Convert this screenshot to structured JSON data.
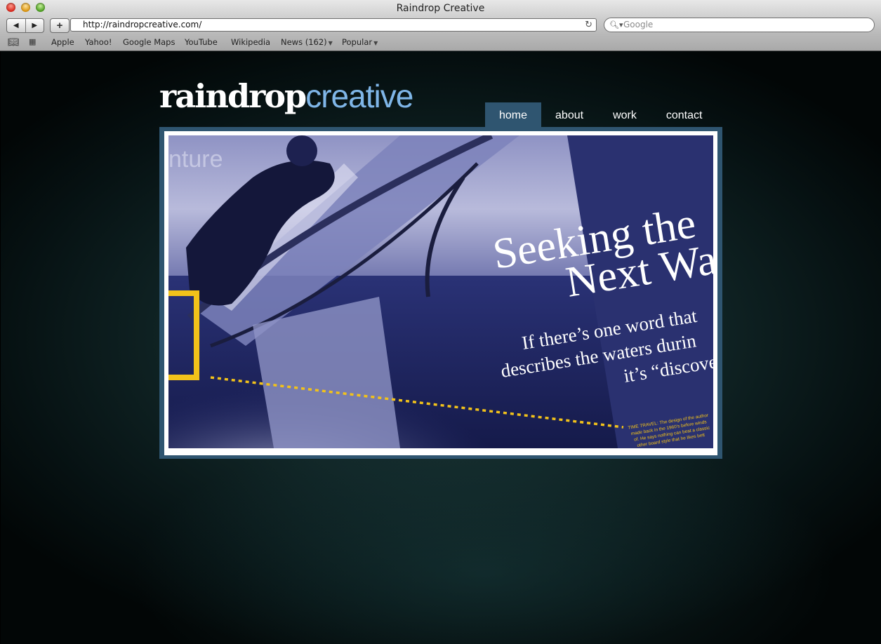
{
  "window": {
    "title": "Raindrop Creative"
  },
  "toolbar": {
    "back_icon": "back-arrow-icon",
    "forward_icon": "forward-arrow-icon",
    "add_label": "+",
    "url": "http://raindropcreative.com/",
    "search_placeholder": "Google"
  },
  "bookmarks": {
    "items": [
      "Apple",
      "Yahoo!",
      "Google Maps",
      "YouTube",
      "Wikipedia",
      "News (162)",
      "Popular"
    ]
  },
  "site": {
    "logo_bold": "raindrop",
    "logo_light": "creative",
    "nav": [
      "home",
      "about",
      "work",
      "contact"
    ],
    "active_nav": "home",
    "hero": {
      "corner_text": "nture",
      "headline_1": "Seeking the",
      "headline_2": "Next Wa",
      "sub_1": "If there’s one word that",
      "sub_2": "describes the waters durin",
      "sub_3": "it’s “discove",
      "caption_1": "TIME TRAVEL: The design of the author",
      "caption_2": "made back in the 1960’s before winds",
      "caption_3": "of. He says nothing can beat a classic",
      "caption_4": "other board style that he likes bett"
    }
  },
  "colors": {
    "accent_nav": "#2f5570",
    "logo_light": "#7fb6e8",
    "highlight_yellow": "#f2c21a",
    "hero_panel": "#2a3170"
  }
}
